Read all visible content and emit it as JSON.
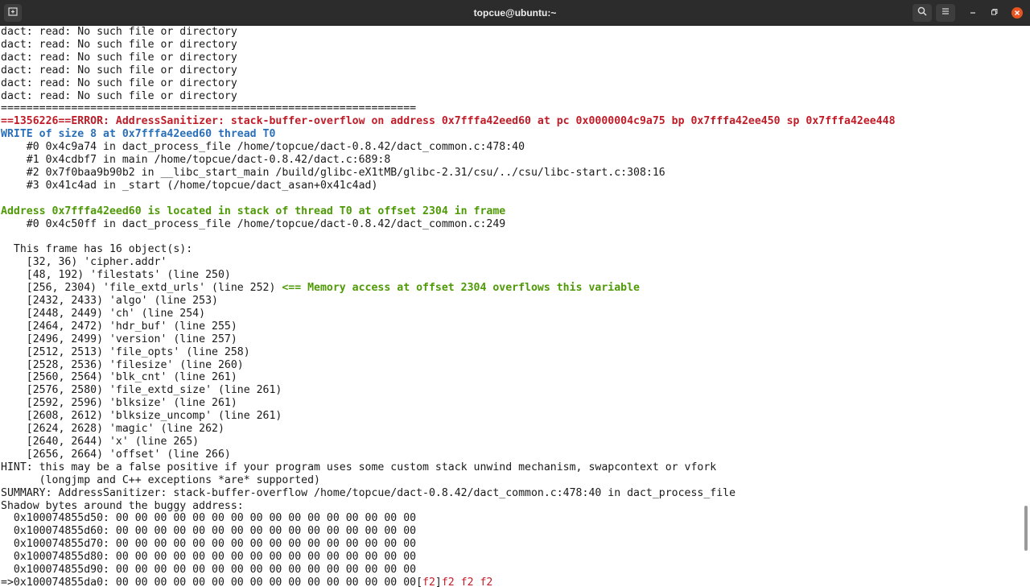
{
  "window": {
    "title": "topcue@ubuntu:~",
    "icons": {
      "new_tab": "new-tab-icon",
      "search": "search-icon",
      "menu": "hamburger-menu-icon",
      "minimize": "minimize-icon",
      "maximize": "maximize-icon",
      "close": "close-icon"
    },
    "colors": {
      "titlebar_bg": "#2c2c2c",
      "close_button": "#e95420",
      "terminal_bg": "#ffffff",
      "error_red": "#c01c28",
      "info_blue": "#2a6fb8",
      "note_green": "#4e9a06"
    }
  },
  "terminal": {
    "lines": [
      [
        {
          "text": "dact: read: No such file or directory"
        }
      ],
      [
        {
          "text": "dact: read: No such file or directory"
        }
      ],
      [
        {
          "text": "dact: read: No such file or directory"
        }
      ],
      [
        {
          "text": "dact: read: No such file or directory"
        }
      ],
      [
        {
          "text": "dact: read: No such file or directory"
        }
      ],
      [
        {
          "text": "dact: read: No such file or directory"
        }
      ],
      [
        {
          "text": "================================================================="
        }
      ],
      [
        {
          "text": "==1356226==ERROR: AddressSanitizer: stack-buffer-overflow on address 0x7fffa42eed60 at pc 0x0000004c9a75 bp 0x7fffa42ee450 sp 0x7fffa42ee448",
          "style": "red"
        }
      ],
      [
        {
          "text": "WRITE of size 8 at 0x7fffa42eed60 thread T0",
          "style": "blue"
        }
      ],
      [
        {
          "text": "    #0 0x4c9a74 in dact_process_file /home/topcue/dact-0.8.42/dact_common.c:478:40"
        }
      ],
      [
        {
          "text": "    #1 0x4cdbf7 in main /home/topcue/dact-0.8.42/dact.c:689:8"
        }
      ],
      [
        {
          "text": "    #2 0x7f0baa9b90b2 in __libc_start_main /build/glibc-eX1tMB/glibc-2.31/csu/../csu/libc-start.c:308:16"
        }
      ],
      [
        {
          "text": "    #3 0x41c4ad in _start (/home/topcue/dact_asan+0x41c4ad)"
        }
      ],
      [
        {
          "text": ""
        }
      ],
      [
        {
          "text": "Address 0x7fffa42eed60 is located in stack of thread T0 at offset 2304 in frame",
          "style": "green"
        }
      ],
      [
        {
          "text": "    #0 0x4c50ff in dact_process_file /home/topcue/dact-0.8.42/dact_common.c:249"
        }
      ],
      [
        {
          "text": ""
        }
      ],
      [
        {
          "text": "  This frame has 16 object(s):"
        }
      ],
      [
        {
          "text": "    [32, 36) 'cipher.addr'"
        }
      ],
      [
        {
          "text": "    [48, 192) 'filestats' (line 250)"
        }
      ],
      [
        {
          "text": "    [256, 2304) 'file_extd_urls' (line 252) "
        },
        {
          "text": "<== Memory access at offset 2304 overflows this variable",
          "style": "green"
        }
      ],
      [
        {
          "text": "    [2432, 2433) 'algo' (line 253)"
        }
      ],
      [
        {
          "text": "    [2448, 2449) 'ch' (line 254)"
        }
      ],
      [
        {
          "text": "    [2464, 2472) 'hdr_buf' (line 255)"
        }
      ],
      [
        {
          "text": "    [2496, 2499) 'version' (line 257)"
        }
      ],
      [
        {
          "text": "    [2512, 2513) 'file_opts' (line 258)"
        }
      ],
      [
        {
          "text": "    [2528, 2536) 'filesize' (line 260)"
        }
      ],
      [
        {
          "text": "    [2560, 2564) 'blk_cnt' (line 261)"
        }
      ],
      [
        {
          "text": "    [2576, 2580) 'file_extd_size' (line 261)"
        }
      ],
      [
        {
          "text": "    [2592, 2596) 'blksize' (line 261)"
        }
      ],
      [
        {
          "text": "    [2608, 2612) 'blksize_uncomp' (line 261)"
        }
      ],
      [
        {
          "text": "    [2624, 2628) 'magic' (line 262)"
        }
      ],
      [
        {
          "text": "    [2640, 2644) 'x' (line 265)"
        }
      ],
      [
        {
          "text": "    [2656, 2664) 'offset' (line 266)"
        }
      ],
      [
        {
          "text": "HINT: this may be a false positive if your program uses some custom stack unwind mechanism, swapcontext or vfork"
        }
      ],
      [
        {
          "text": "      (longjmp and C++ exceptions *are* supported)"
        }
      ],
      [
        {
          "text": "SUMMARY: AddressSanitizer: stack-buffer-overflow /home/topcue/dact-0.8.42/dact_common.c:478:40 in dact_process_file"
        }
      ],
      [
        {
          "text": "Shadow bytes around the buggy address:"
        }
      ],
      [
        {
          "text": "  0x100074855d50: 00 00 00 00 00 00 00 00 00 00 00 00 00 00 00 00"
        }
      ],
      [
        {
          "text": "  0x100074855d60: 00 00 00 00 00 00 00 00 00 00 00 00 00 00 00 00"
        }
      ],
      [
        {
          "text": "  0x100074855d70: 00 00 00 00 00 00 00 00 00 00 00 00 00 00 00 00"
        }
      ],
      [
        {
          "text": "  0x100074855d80: 00 00 00 00 00 00 00 00 00 00 00 00 00 00 00 00"
        }
      ],
      [
        {
          "text": "  0x100074855d90: 00 00 00 00 00 00 00 00 00 00 00 00 00 00 00 00"
        }
      ],
      [
        {
          "text": "=>0x100074855da0: 00 00 00 00 00 00 00 00 00 00 00 00 00 00 00 00["
        },
        {
          "text": "f2",
          "style": "redtxt"
        },
        {
          "text": "]"
        },
        {
          "text": "f2 f2 f2",
          "style": "redtxt"
        }
      ]
    ]
  }
}
